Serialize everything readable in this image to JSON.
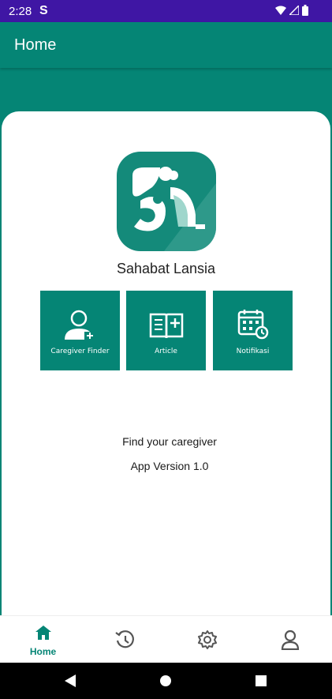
{
  "status_bar": {
    "time": "2:28",
    "notification_icon": "S",
    "icons": [
      "wifi-icon",
      "signal-icon",
      "battery-icon"
    ]
  },
  "app_bar": {
    "title": "Home"
  },
  "app": {
    "name": "Sahabat Lansia",
    "logo_icon": "sahabat-lansia-logo"
  },
  "tiles": [
    {
      "label": "Caregiver Finder",
      "icon": "caregiver-icon"
    },
    {
      "label": "Article",
      "icon": "book-icon"
    },
    {
      "label": "Notifikasi",
      "icon": "calendar-icon"
    }
  ],
  "info": {
    "tagline": "Find your caregiver",
    "version": "App Version 1.0"
  },
  "bottom_nav": {
    "items": [
      {
        "label": "Home",
        "icon": "home-icon",
        "active": true
      },
      {
        "label": "",
        "icon": "history-icon",
        "active": false
      },
      {
        "label": "",
        "icon": "settings-icon",
        "active": false
      },
      {
        "label": "",
        "icon": "profile-icon",
        "active": false
      }
    ]
  },
  "colors": {
    "primary": "#058575",
    "status_bar": "#3F16A4",
    "background": "#FFFFFF",
    "icon_gray": "#555555"
  }
}
